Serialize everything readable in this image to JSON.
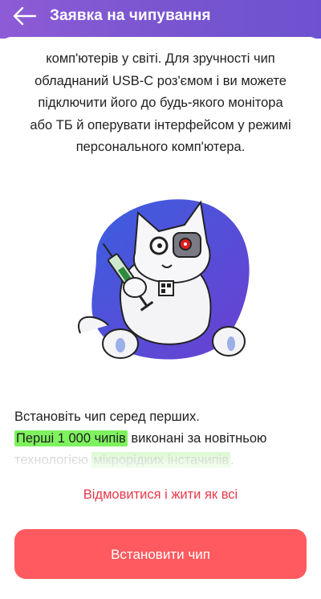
{
  "header": {
    "title": "Заявка на чипування",
    "back_icon": "arrow-left-icon"
  },
  "intro": {
    "line1": "комп'ютерів у світі. Для зручності чип",
    "line2": "обладнаний USB-C роз'ємом і ви можете",
    "line3": "підключити його до будь-якого монітора",
    "line4": "або ТБ й оперувати інтерфейсом у режимі",
    "line5": "персонального комп'ютера."
  },
  "illustration": {
    "subject": "cyborg-cat-with-syringe-illustration",
    "colors": {
      "blob_start": "#3a5fe0",
      "blob_end": "#6d3fd0",
      "eye": "#e01e1e"
    }
  },
  "offer": {
    "line1": "Встановіть чип серед перших.",
    "highlight1": "Перші 1 000 чипів",
    "line2_rest": " виконані за новітньою",
    "line3_start": "технологією ",
    "highlight2": "мікрорідких інстачипів",
    "line3_end": "."
  },
  "actions": {
    "decline_label": "Відмовитися і жити як всі",
    "install_label": "Встановити чип"
  },
  "colors": {
    "header_gradient_start": "#8e5bd6",
    "header_gradient_end": "#6d52cf",
    "highlight": "#7ef25f",
    "decline_text": "#e8394a",
    "install_button": "#ff5a5f"
  }
}
